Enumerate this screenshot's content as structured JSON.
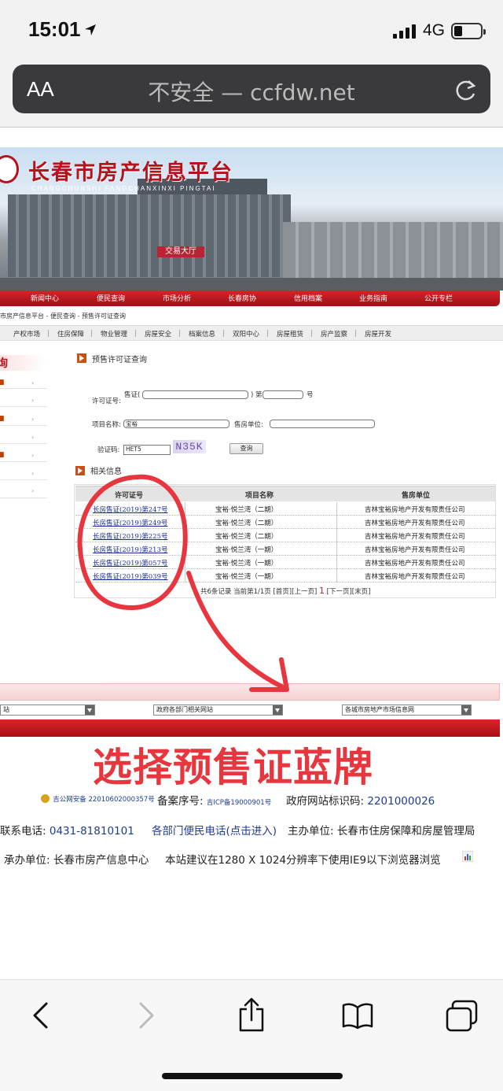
{
  "status_bar": {
    "time": "15:01",
    "carrier": "4G"
  },
  "browser": {
    "aa_label": "AA",
    "url_text": "不安全 — ccfdw.net"
  },
  "site": {
    "title": "长春市房产信息平台",
    "subtitle": "CHANGCHUNSHI FANGCHANXINXI PINGTAI",
    "entrance_sign": "交易大厅",
    "nav": [
      "新闻中心",
      "便民查询",
      "市场分析",
      "长春房协",
      "信用档案",
      "业务指南",
      "公开专栏"
    ],
    "breadcrumb": "市房产信息平台 - 便民查询 - 预售许可证查询",
    "subnav": [
      "产权市场",
      "住房保障",
      "物业管理",
      "房屋安全",
      "档案信息",
      "双阳中心",
      "房屋租赁",
      "房产监察",
      "房屋开发"
    ],
    "left_head": "询"
  },
  "query": {
    "section_title": "预售许可证查询",
    "permit_label": "许可证号:",
    "permit_prefix": "售证(",
    "permit_mid": ") 第",
    "permit_suffix": "号",
    "project_label": "项目名称:",
    "project_value": "宝裕",
    "seller_label": "售房单位:",
    "captcha_label": "验证码:",
    "captcha_input": "HET5",
    "captcha_image": "N35K",
    "search_button": "查询"
  },
  "results": {
    "section_title": "相关信息",
    "headers": [
      "许可证号",
      "项目名称",
      "售房单位"
    ],
    "rows": [
      [
        "长房售证(2019)第247号",
        "宝裕·悦兰湾（二期）",
        "吉林宝裕房地产开发有限责任公司"
      ],
      [
        "长房售证(2019)第249号",
        "宝裕·悦兰湾（二期）",
        "吉林宝裕房地产开发有限责任公司"
      ],
      [
        "长房售证(2019)第225号",
        "宝裕·悦兰湾（二期）",
        "吉林宝裕房地产开发有限责任公司"
      ],
      [
        "长房售证(2019)第213号",
        "宝裕·悦兰湾（一期）",
        "吉林宝裕房地产开发有限责任公司"
      ],
      [
        "长房售证(2019)第057号",
        "宝裕·悦兰湾（一期）",
        "吉林宝裕房地产开发有限责任公司"
      ],
      [
        "长房售证(2019)第039号",
        "宝裕·悦兰湾（一期）",
        "吉林宝裕房地产开发有限责任公司"
      ]
    ],
    "pager_pre": "共6条记录 当前第1/1页 [首页][上一页]",
    "pager_current": "1",
    "pager_post": "[下一页][末页]"
  },
  "footer_links": {
    "select1": "站",
    "select2": "政府各部门相关网站",
    "select3": "各城市房地产市场信息网"
  },
  "annotation": {
    "text": "选择预售证蓝牌"
  },
  "footer": {
    "police_record": "吉公网安备 22010602000357号",
    "icp_label": "备案序号:",
    "icp_value": "吉ICP备19000901号",
    "gov_label": "政府网站标识码:",
    "gov_value": "2201000026",
    "phone_label": "联系电话:",
    "phone_value": "0431-81810101",
    "hotline": "各部门便民电话(点击进入)",
    "host_label": "主办单位:",
    "host_value": "长春市住房保障和房屋管理局",
    "org_label": "承办单位:",
    "org_value": "长春市房产信息中心",
    "browser_tip": "本站建议在1280 X 1024分辨率下使用IE9以下浏览器浏览"
  },
  "colors": {
    "brand_red": "#b5121b",
    "link_blue": "#1a2ea0",
    "annotation_red": "#e8363f"
  }
}
